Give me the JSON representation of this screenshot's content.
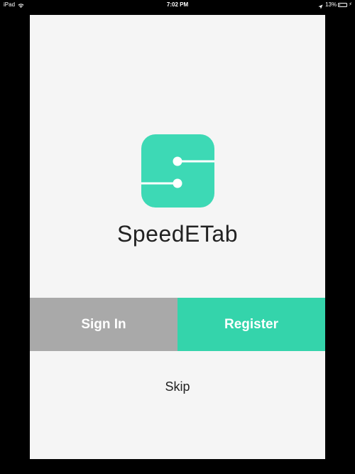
{
  "status_bar": {
    "carrier": "iPad",
    "time": "7:02 PM",
    "battery_percent": "13%",
    "battery_level": 0.13,
    "icons": [
      "wifi-icon",
      "location-arrow-icon",
      "battery-icon",
      "charging-bolt-icon"
    ]
  },
  "app": {
    "name": "SpeedETab",
    "logo_icon": "speedetab-logo-icon",
    "brand_color": "#3dd9b5"
  },
  "buttons": {
    "sign_in": "Sign In",
    "register": "Register",
    "skip": "Skip"
  },
  "colors": {
    "sign_in_bg": "#a9a9a9",
    "register_bg": "#34d4ab",
    "panel_bg": "#f5f5f5"
  }
}
